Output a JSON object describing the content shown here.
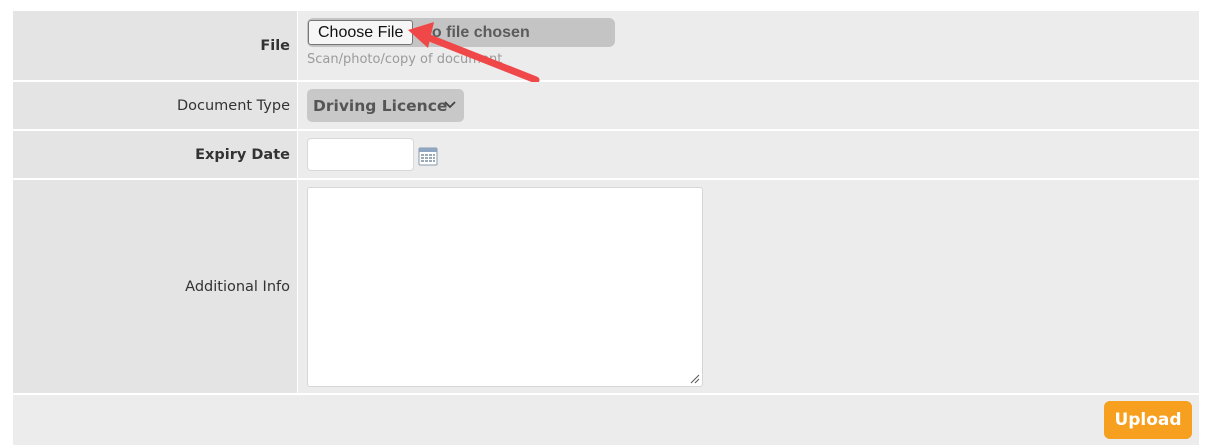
{
  "form": {
    "file": {
      "label": "File",
      "choose_button": "Choose File",
      "status": "No file chosen",
      "hint": "Scan/photo/copy of document"
    },
    "document_type": {
      "label": "Document Type",
      "selected": "Driving Licence",
      "icon": "chevron-down-icon"
    },
    "expiry_date": {
      "label": "Expiry Date",
      "value": "",
      "icon": "calendar-icon"
    },
    "additional_info": {
      "label": "Additional Info",
      "value": ""
    },
    "upload_button": "Upload"
  },
  "colors": {
    "accent": "#f7a01f",
    "annotation_arrow": "#f04848",
    "label_bg": "#e4e4e4",
    "field_bg": "#ececec"
  }
}
